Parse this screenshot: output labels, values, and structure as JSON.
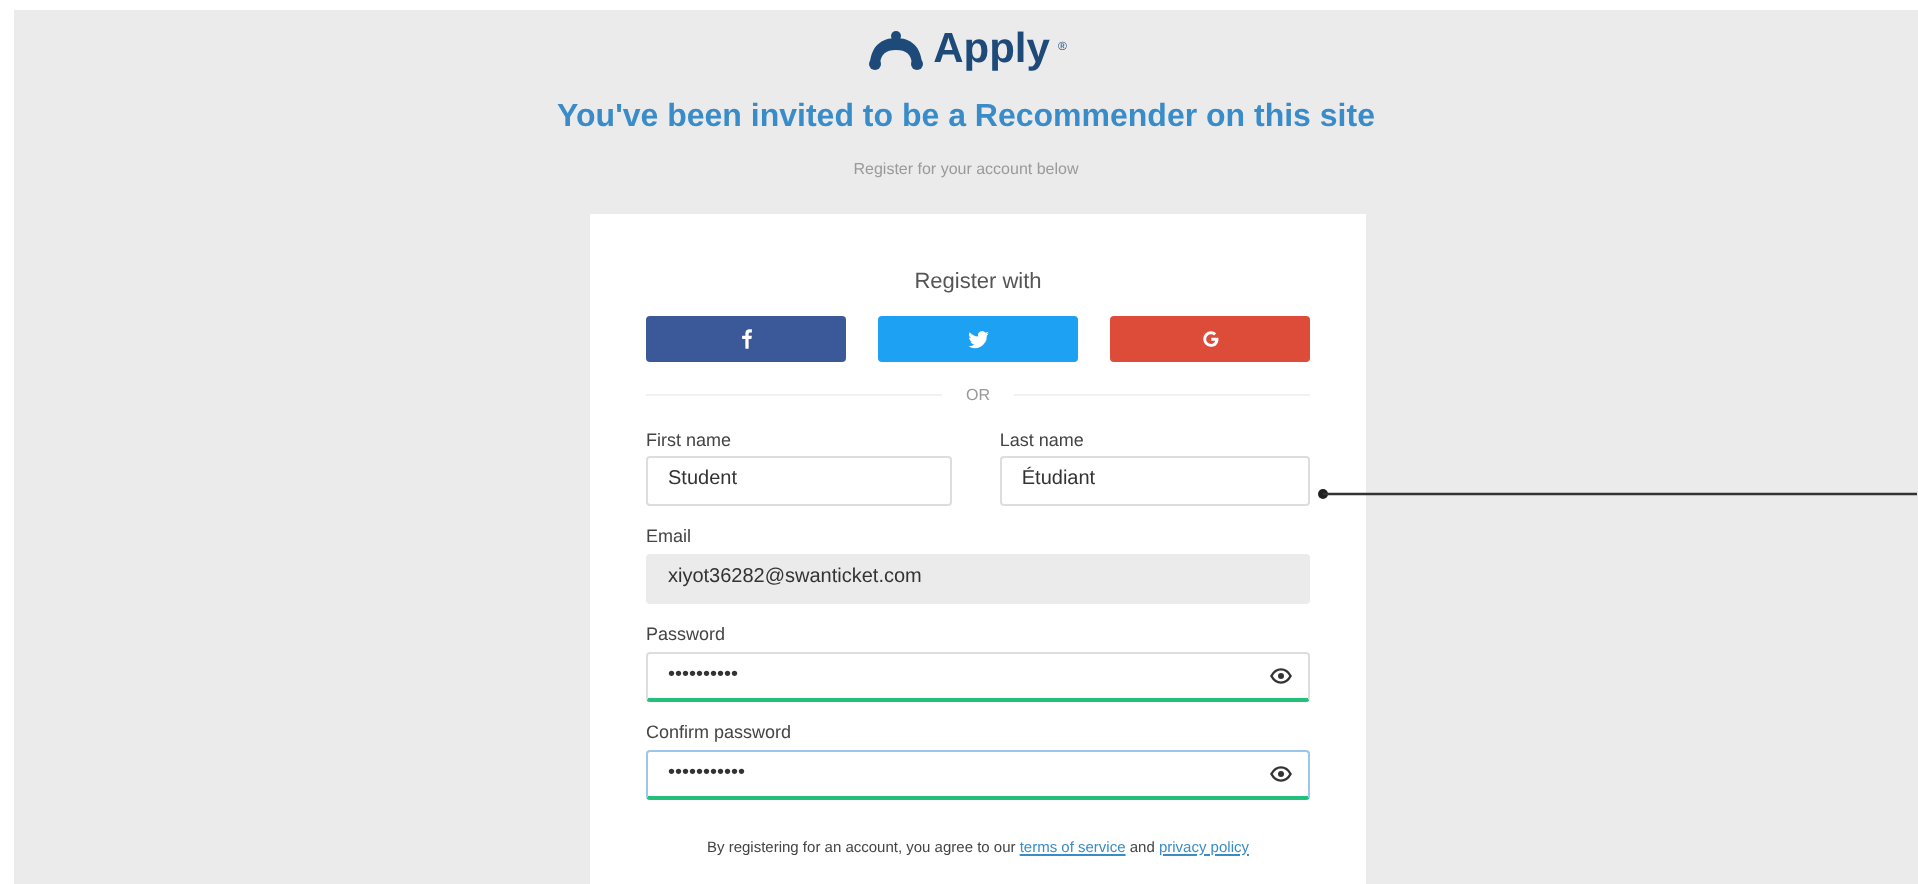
{
  "logo": {
    "text": "Apply",
    "mark": "®"
  },
  "heading": "You've been invited to be a Recommender on this site",
  "subheading": "Register for your account below",
  "form": {
    "register_with": "Register with",
    "social_buttons": [
      {
        "kind": "facebook",
        "color": "#3b5998"
      },
      {
        "kind": "twitter",
        "color": "#1da1f2"
      },
      {
        "kind": "google",
        "color": "#dd4b39"
      }
    ],
    "divider": "OR",
    "fields": [
      {
        "label": "First name",
        "value": "Student",
        "kind": "text",
        "disabled": false,
        "valid": false,
        "focused": false
      },
      {
        "label": "Last name",
        "value": "Étudiant",
        "kind": "text",
        "disabled": false,
        "valid": false,
        "focused": false
      },
      {
        "label": "Email",
        "value": "xiyot36282@swanticket.com",
        "kind": "text",
        "disabled": true,
        "valid": false,
        "focused": false
      },
      {
        "label": "Password",
        "value": "••••••••••",
        "kind": "password",
        "disabled": false,
        "valid": true,
        "focused": false
      },
      {
        "label": "Confirm password",
        "value": "•••••••••••",
        "kind": "password",
        "disabled": false,
        "valid": true,
        "focused": true
      }
    ],
    "terms": {
      "before": "By registering for an account, you agree to our",
      "link1": "terms of service",
      "middle": "and",
      "link2": "privacy policy"
    }
  }
}
